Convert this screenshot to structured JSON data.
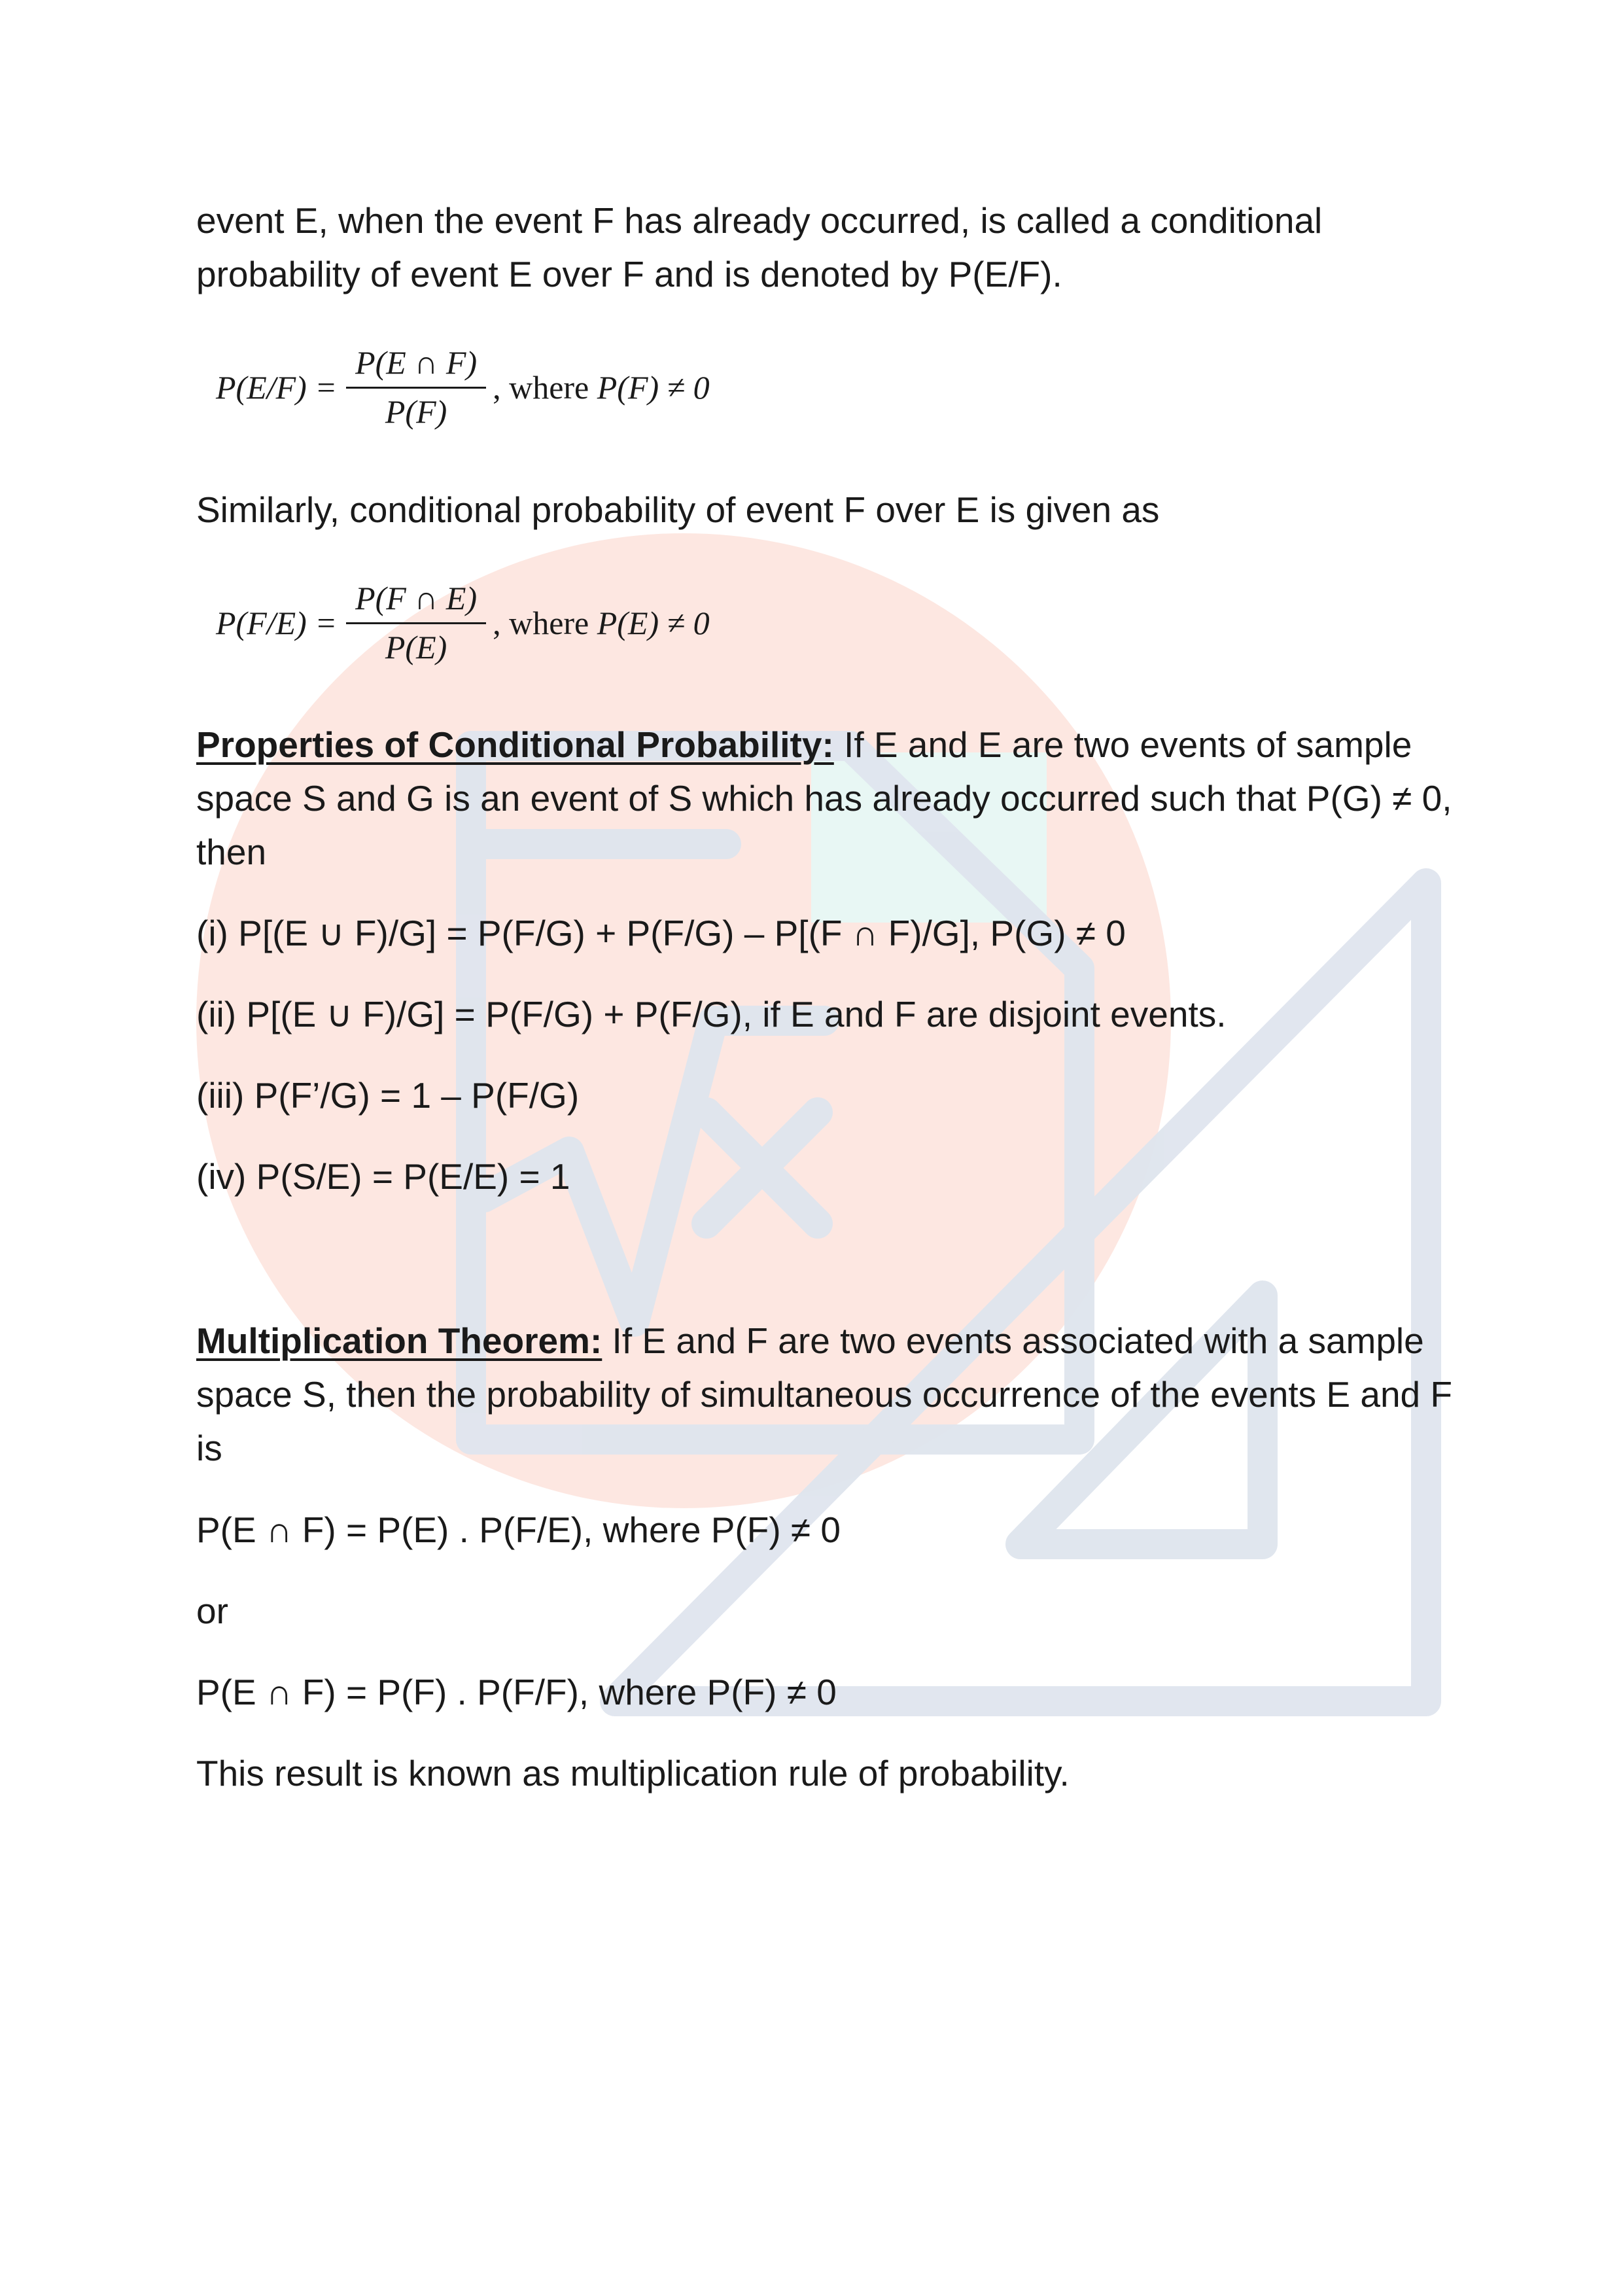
{
  "intro": {
    "line1": "event E, when the event F has already occurred, is called a conditional",
    "line2": "probability of event E over F and is denoted by P(E/F)."
  },
  "formula1": {
    "lhs": "P(E/F) =",
    "numerator": "P(E ∩ F)",
    "denominator": "P(F)",
    "where_word": "where",
    "condition": "P(F) ≠ 0"
  },
  "similarly_text": "Similarly, conditional probability of event F over E is given as",
  "formula2": {
    "lhs": "P(F/E) =",
    "numerator": "P(F ∩ E)",
    "denominator": "P(E)",
    "where_word": "where",
    "condition": "P(E) ≠ 0"
  },
  "properties": {
    "heading": "Properties of Conditional Probability:",
    "intro_line1": " If E and E are two events of sample",
    "intro_line2": "space S and G is an event of S which has already occurred such that P(G) ≠ 0,",
    "intro_line3": "then",
    "items": [
      "(i) P[(E ∪ F)/G] = P(F/G) + P(F/G) – P[(F ∩ F)/G], P(G) ≠ 0",
      "(ii) P[(E ∪ F)/G] = P(F/G) + P(F/G), if E and F are disjoint events.",
      "(iii) P(F’/G) = 1 – P(F/G)",
      "(iv) P(S/E) = P(E/E) = 1"
    ]
  },
  "multiplication": {
    "heading": "Multiplication Theorem:",
    "intro_line1": " If E and F are two events associated with a sample",
    "intro_line2": "space S, then the probability of simultaneous occurrence of the events E and F",
    "intro_line3": "is",
    "formula_a": "P(E ∩ F) = P(E) . P(F/E), where P(F) ≠ 0",
    "or_text": "or",
    "formula_b": "P(E ∩ F) = P(F) . P(F/F), where P(F) ≠ 0",
    "conclusion": "This result is known as multiplication rule of probability."
  },
  "colors": {
    "text": "#1a1a1a",
    "watermark_circle": "#fde3dc",
    "watermark_shape": "#dfe5ee",
    "watermark_accent": "#e6f8f6"
  }
}
